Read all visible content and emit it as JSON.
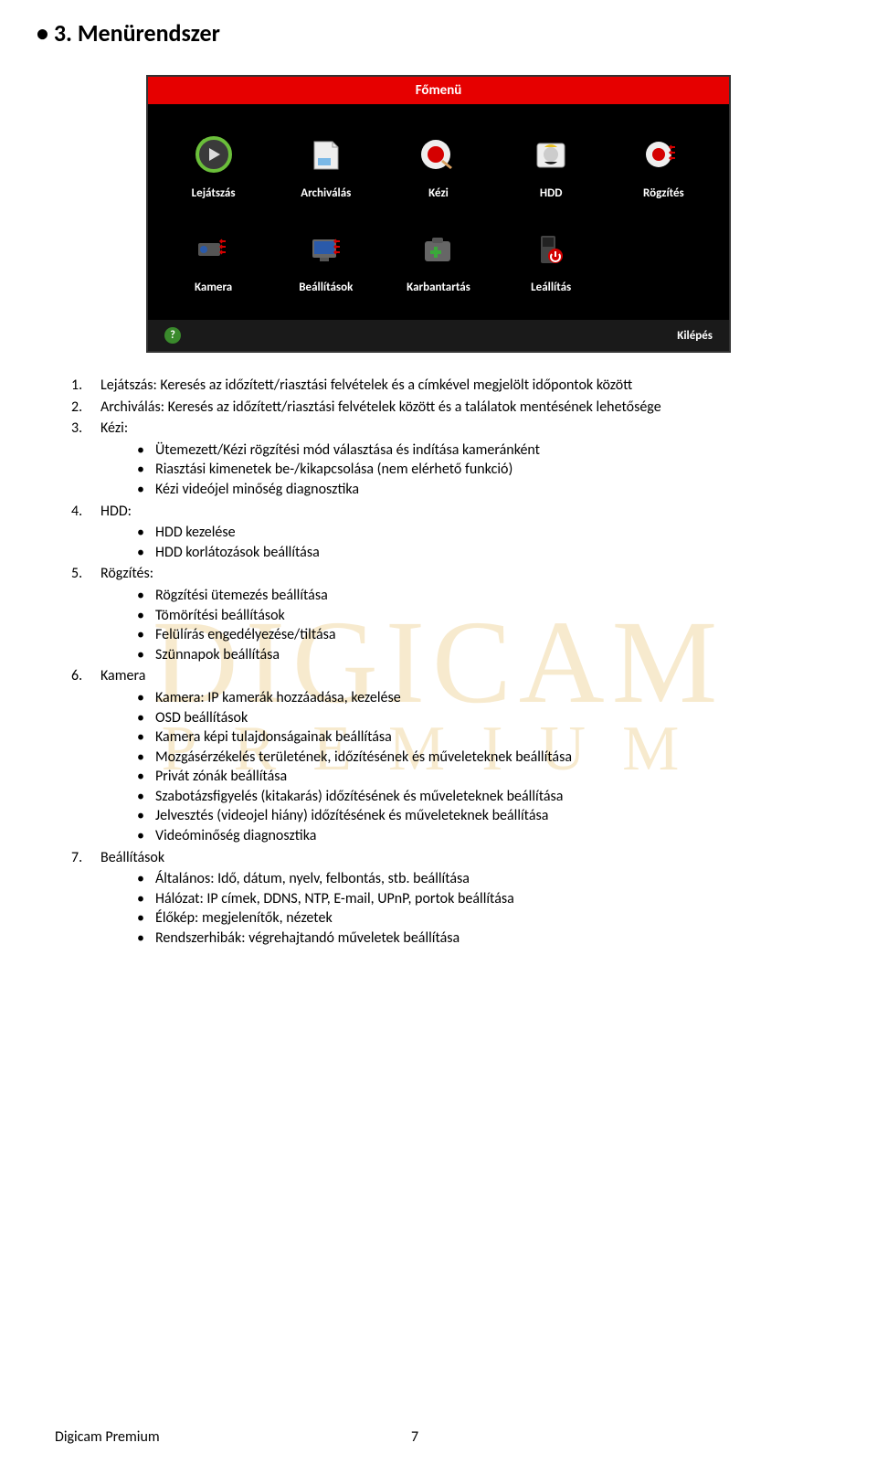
{
  "watermark": {
    "line1": "DIGICAM",
    "line2": "PREMIUM"
  },
  "section_title": "3. Menürendszer",
  "screenshot": {
    "title": "Főmenü",
    "items": [
      {
        "id": "lejatszas",
        "label": "Lejátszás"
      },
      {
        "id": "archivalas",
        "label": "Archiválás"
      },
      {
        "id": "kezi",
        "label": "Kézi"
      },
      {
        "id": "hdd",
        "label": "HDD"
      },
      {
        "id": "rogzites",
        "label": "Rögzítés"
      },
      {
        "id": "kamera",
        "label": "Kamera"
      },
      {
        "id": "beallitasok",
        "label": "Beállítások"
      },
      {
        "id": "karbantartas",
        "label": "Karbantartás"
      },
      {
        "id": "leallitas",
        "label": "Leállítás"
      }
    ],
    "exit": "Kilépés",
    "help": "?"
  },
  "list": [
    {
      "title": "Lejátszás:",
      "body": "Keresés az időzített/riasztási felvételek és a címkével megjelölt időpontok között",
      "sub": []
    },
    {
      "title": "Archiválás:",
      "body": "Keresés az időzített/riasztási felvételek között és a találatok mentésének lehetősége",
      "sub": []
    },
    {
      "title": "Kézi:",
      "body": "",
      "sub": [
        "Ütemezett/Kézi rögzítési mód választása és indítása kameránként",
        "Riasztási kimenetek be-/kikapcsolása (nem elérhető funkció)",
        "Kézi videójel minőség diagnosztika"
      ]
    },
    {
      "title": "HDD:",
      "body": "",
      "sub": [
        "HDD kezelése",
        "HDD korlátozások beállítása"
      ]
    },
    {
      "title": "Rögzítés:",
      "body": "",
      "sub": [
        "Rögzítési ütemezés beállítása",
        "Tömörítési beállítások",
        "Felülírás engedélyezése/tiltása",
        "Szünnapok beállítása"
      ]
    },
    {
      "title": "Kamera",
      "body": "",
      "sub": [
        "Kamera: IP kamerák hozzáadása, kezelése",
        "OSD beállítások",
        "Kamera képi tulajdonságainak beállítása",
        "Mozgásérzékelés területének, időzítésének és műveleteknek beállítása",
        "Privát zónák beállítása",
        "Szabotázsfigyelés (kitakarás) időzítésének és műveleteknek beállítása",
        "Jelvesztés (videojel hiány) időzítésének és műveleteknek beállítása",
        "Videóminőség diagnosztika"
      ]
    },
    {
      "title": "Beállítások",
      "body": "",
      "sub": [
        "Általános: Idő, dátum, nyelv, felbontás, stb. beállítása",
        "Hálózat: IP címek, DDNS, NTP, E-mail, UPnP, portok beállítása",
        "Élőkép: megjelenítők, nézetek",
        "Rendszerhibák: végrehajtandó műveletek beállítása"
      ]
    }
  ],
  "footer": {
    "left": "Digicam Premium",
    "page": "7"
  }
}
